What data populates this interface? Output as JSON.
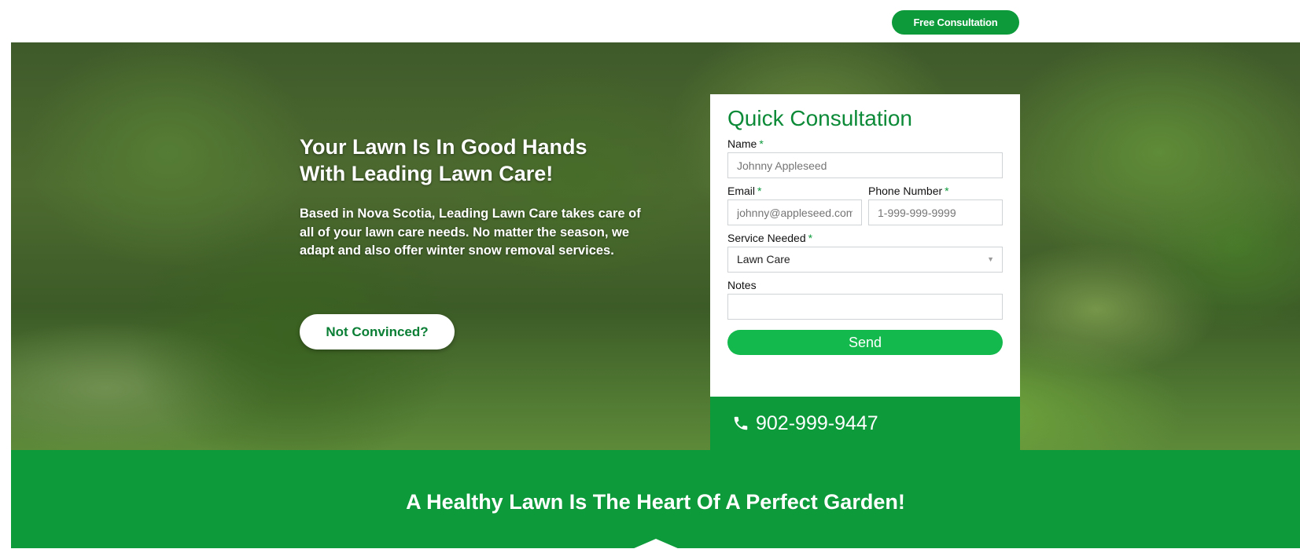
{
  "header": {
    "cta_label": "Free Consultation"
  },
  "hero": {
    "title_line1": "Your Lawn Is In Good Hands",
    "title_line2": "With Leading Lawn Care!",
    "body": "Based in Nova Scotia, Leading Lawn Care takes care of all of your lawn care needs. No matter the season, we adapt and also offer winter snow removal services.",
    "button_label": "Not Convinced?"
  },
  "form": {
    "title": "Quick Consultation",
    "required_mark": "*",
    "name_label": "Name",
    "name_placeholder": "Johnny Appleseed",
    "email_label": "Email",
    "email_placeholder": "johnny@appleseed.com",
    "phone_label": "Phone Number",
    "phone_placeholder": "1-999-999-9999",
    "service_label": "Service Needed",
    "service_value": "Lawn Care",
    "notes_label": "Notes",
    "send_label": "Send"
  },
  "contact": {
    "phone": "902-999-9447",
    "icon": "phone-icon"
  },
  "band": {
    "title": "A Healthy Lawn Is The Heart Of A Perfect Garden!"
  },
  "colors": {
    "brand_green": "#0c9a3b",
    "button_green": "#13b94c",
    "title_green": "#0c8a37"
  }
}
